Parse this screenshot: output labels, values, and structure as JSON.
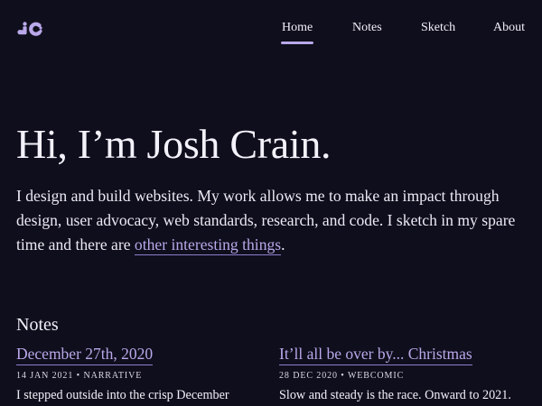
{
  "header": {
    "logo_icon": "jc-monogram-logo",
    "nav": [
      {
        "label": "Home",
        "active": true
      },
      {
        "label": "Notes",
        "active": false
      },
      {
        "label": "Sketch",
        "active": false
      },
      {
        "label": "About",
        "active": false
      }
    ]
  },
  "hero": {
    "title": "Hi, I’m Josh Crain.",
    "intro_text": "I design and build websites. My work allows me to make an impact through design, user advocacy, web standards, research, and code. I sketch in my spare time and there are ",
    "intro_link": "other interesting things",
    "intro_end": "."
  },
  "notes": {
    "heading": "Notes",
    "items": [
      {
        "title": "December 27th, 2020",
        "date": "14 JAN 2021",
        "category": "NARRATIVE",
        "excerpt": "I stepped outside into the crisp December"
      },
      {
        "title": "It’ll all be over by... Christmas",
        "date": "28 DEC 2020",
        "category": "WEBCOMIC",
        "excerpt": "Slow and steady is the race. Onward to 2021."
      }
    ]
  },
  "colors": {
    "background": "#0f0e1c",
    "accent": "#b9a8ea",
    "text": "#f1eff8"
  }
}
